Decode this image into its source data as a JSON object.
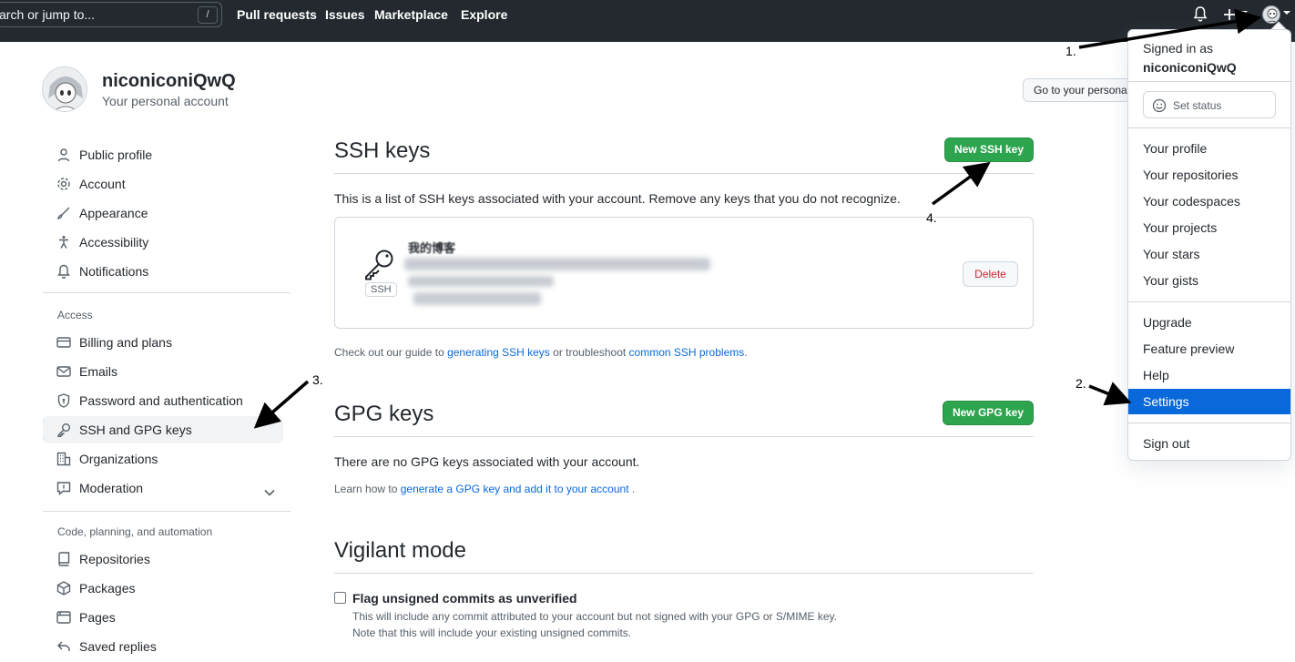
{
  "header": {
    "search_placeholder": "arch or jump to...",
    "slash_key": "/",
    "nav": [
      "Pull requests",
      "Issues",
      "Marketplace",
      "Explore"
    ],
    "icons": [
      "bell-icon",
      "plus-icon",
      "avatar-icon"
    ]
  },
  "profile": {
    "username": "niconiconiQwQ",
    "subtitle": "Your personal account",
    "goto_button": "Go to your personal profile"
  },
  "sidebar": {
    "group1": [
      {
        "label": "Public profile",
        "icon": "person-icon"
      },
      {
        "label": "Account",
        "icon": "gear-icon"
      },
      {
        "label": "Appearance",
        "icon": "paintbrush-icon"
      },
      {
        "label": "Accessibility",
        "icon": "accessibility-icon"
      },
      {
        "label": "Notifications",
        "icon": "bell-icon"
      }
    ],
    "access_heading": "Access",
    "group2": [
      {
        "label": "Billing and plans",
        "icon": "credit-card-icon"
      },
      {
        "label": "Emails",
        "icon": "mail-icon"
      },
      {
        "label": "Password and authentication",
        "icon": "shield-lock-icon"
      },
      {
        "label": "SSH and GPG keys",
        "icon": "key-icon"
      },
      {
        "label": "Organizations",
        "icon": "organization-icon"
      },
      {
        "label": "Moderation",
        "icon": "report-icon"
      }
    ],
    "code_heading": "Code, planning, and automation",
    "group3": [
      {
        "label": "Repositories",
        "icon": "repo-icon"
      },
      {
        "label": "Packages",
        "icon": "package-icon"
      },
      {
        "label": "Pages",
        "icon": "browser-icon"
      },
      {
        "label": "Saved replies",
        "icon": "reply-icon"
      }
    ]
  },
  "ssh": {
    "title": "SSH keys",
    "new_button": "New SSH key",
    "description": "This is a list of SSH keys associated with your account. Remove any keys that you do not recognize.",
    "key_title": "我的博客",
    "key_badge": "SSH",
    "delete_button": "Delete",
    "guide_prefix": "Check out our guide to ",
    "guide_link1": "generating SSH keys",
    "guide_middle": " or troubleshoot ",
    "guide_link2": "common SSH problems",
    "guide_suffix": "."
  },
  "gpg": {
    "title": "GPG keys",
    "new_button": "New GPG key",
    "empty": "There are no GPG keys associated with your account.",
    "learn_prefix": "Learn how to ",
    "learn_link": "generate a GPG key and add it to your account",
    "learn_suffix": " ."
  },
  "vigilant": {
    "title": "Vigilant mode",
    "checkbox_label": "Flag unsigned commits as unverified",
    "note1": "This will include any commit attributed to your account but not signed with your GPG or S/MIME key.",
    "note2": "Note that this will include your existing unsigned commits."
  },
  "dropdown": {
    "signed_in_as": "Signed in as",
    "username": "niconiconiQwQ",
    "set_status": "Set status",
    "group1": [
      "Your profile",
      "Your repositories",
      "Your codespaces",
      "Your projects",
      "Your stars",
      "Your gists"
    ],
    "group2": [
      "Upgrade",
      "Feature preview",
      "Help",
      "Settings"
    ],
    "sign_out": "Sign out"
  },
  "annotations": [
    "1.",
    "2.",
    "3.",
    "4."
  ],
  "colors": {
    "header_bg": "#24292f",
    "primary_green": "#2da44e",
    "highlight_blue": "#0969da",
    "danger_red": "#cf222e"
  }
}
